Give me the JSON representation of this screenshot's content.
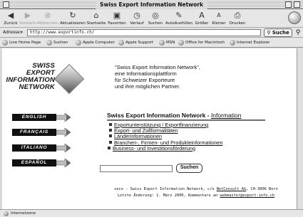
{
  "window": {
    "title": "Swiss Export Information Network"
  },
  "toolbar": {
    "buttons": [
      {
        "label": "Zurück",
        "icon": "back-arrow-icon",
        "enabled": true
      },
      {
        "label": "Vorwärts",
        "icon": "forward-arrow-icon",
        "enabled": false
      },
      {
        "label": "Abbrechen",
        "icon": "stop-icon",
        "enabled": false
      },
      {
        "label": "Aktualisieren",
        "icon": "refresh-icon",
        "enabled": true
      },
      {
        "label": "Startseite",
        "icon": "home-icon",
        "enabled": true
      },
      {
        "label": "Favoriten",
        "icon": "favorites-icon",
        "enabled": true
      },
      {
        "label": "Verlauf",
        "icon": "history-icon",
        "enabled": true
      },
      {
        "label": "Suchen",
        "icon": "search-icon",
        "enabled": true
      },
      {
        "label": "AutoAusfüllen",
        "icon": "autofill-icon",
        "enabled": true
      },
      {
        "label": "Größer",
        "icon": "larger-text-icon",
        "enabled": true
      },
      {
        "label": "Kleiner",
        "icon": "smaller-text-icon",
        "enabled": true
      },
      {
        "label": "Drucken",
        "icon": "print-icon",
        "enabled": true
      }
    ]
  },
  "address": {
    "label": "Adresse:",
    "value": "http://www.exportinfo.ch/",
    "search_button": "Suche"
  },
  "favorites": [
    "Live Home Page",
    "Suchen",
    "Apple Computer",
    "Apple Support",
    "MSN",
    "Office for Macintosh",
    "Internet Explorer"
  ],
  "logo": {
    "lines": [
      "SWISS",
      "EXPORT",
      "INFORMATION",
      "NETWORK"
    ]
  },
  "intro": {
    "lines": [
      "\"Swiss Export Information Network\",",
      "eine Informationsplattform",
      "für Schweizer Exporteure",
      "und ihre möglichen Partner."
    ]
  },
  "languages": [
    "ENGLISH",
    "FRANÇAIS",
    "ITALIANO",
    "ESPAÑOL"
  ],
  "main": {
    "heading": "Swiss Export Information Network - ",
    "heading_link": "Information",
    "links": [
      "Exportunterstützung / Exportfinanzierung",
      "Export- und Zollformalitäten",
      "Länderinformationen",
      "Branchen-, Firmen- und Produkteinformationen",
      "Business- und Investitionsförderung"
    ],
    "search_button": "Suchen",
    "search_value": ""
  },
  "footer": {
    "line1_prefix": "seco - Swiss Export Information Network, c/o ",
    "line1_link": "NetConsult AG",
    "line1_suffix": ", CH-3006 Bern",
    "line2_prefix": "Letzte Änderung: 1. März 2000, Kommentare an ",
    "line2_link": "webmaster@export-info.ch"
  },
  "status": {
    "text": "Internetzone"
  }
}
